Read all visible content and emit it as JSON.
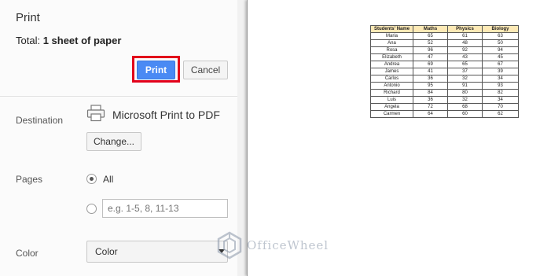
{
  "dialog": {
    "title": "Print",
    "total_prefix": "Total: ",
    "total_value": "1 sheet of paper"
  },
  "buttons": {
    "print": "Print",
    "cancel": "Cancel",
    "change": "Change..."
  },
  "destination": {
    "label": "Destination",
    "printer_name": "Microsoft Print to PDF",
    "icon": "printer-icon"
  },
  "pages": {
    "label": "Pages",
    "option_all": "All",
    "selected": "All",
    "custom_placeholder": "e.g. 1-5, 8, 11-13"
  },
  "color": {
    "label": "Color",
    "selected": "Color"
  },
  "preview": {
    "headers": [
      "Students' Name",
      "Maths",
      "Physics",
      "Biology"
    ],
    "rows": [
      [
        "Maria",
        "65",
        "61",
        "63"
      ],
      [
        "Ana",
        "52",
        "48",
        "50"
      ],
      [
        "Rosa",
        "96",
        "92",
        "94"
      ],
      [
        "Elizabeth",
        "47",
        "43",
        "45"
      ],
      [
        "Andrea",
        "69",
        "65",
        "67"
      ],
      [
        "James",
        "41",
        "37",
        "39"
      ],
      [
        "Carlos",
        "36",
        "32",
        "34"
      ],
      [
        "Antonio",
        "95",
        "91",
        "93"
      ],
      [
        "Richard",
        "84",
        "80",
        "82"
      ],
      [
        "Luis",
        "36",
        "32",
        "34"
      ],
      [
        "Angela",
        "72",
        "68",
        "70"
      ],
      [
        "Carmen",
        "64",
        "60",
        "62"
      ]
    ]
  },
  "watermark": {
    "text": "OfficeWheel"
  },
  "colors": {
    "print_button": "#4a8af4",
    "highlight_border": "#e2001a",
    "table_header": "#fde9b5"
  }
}
